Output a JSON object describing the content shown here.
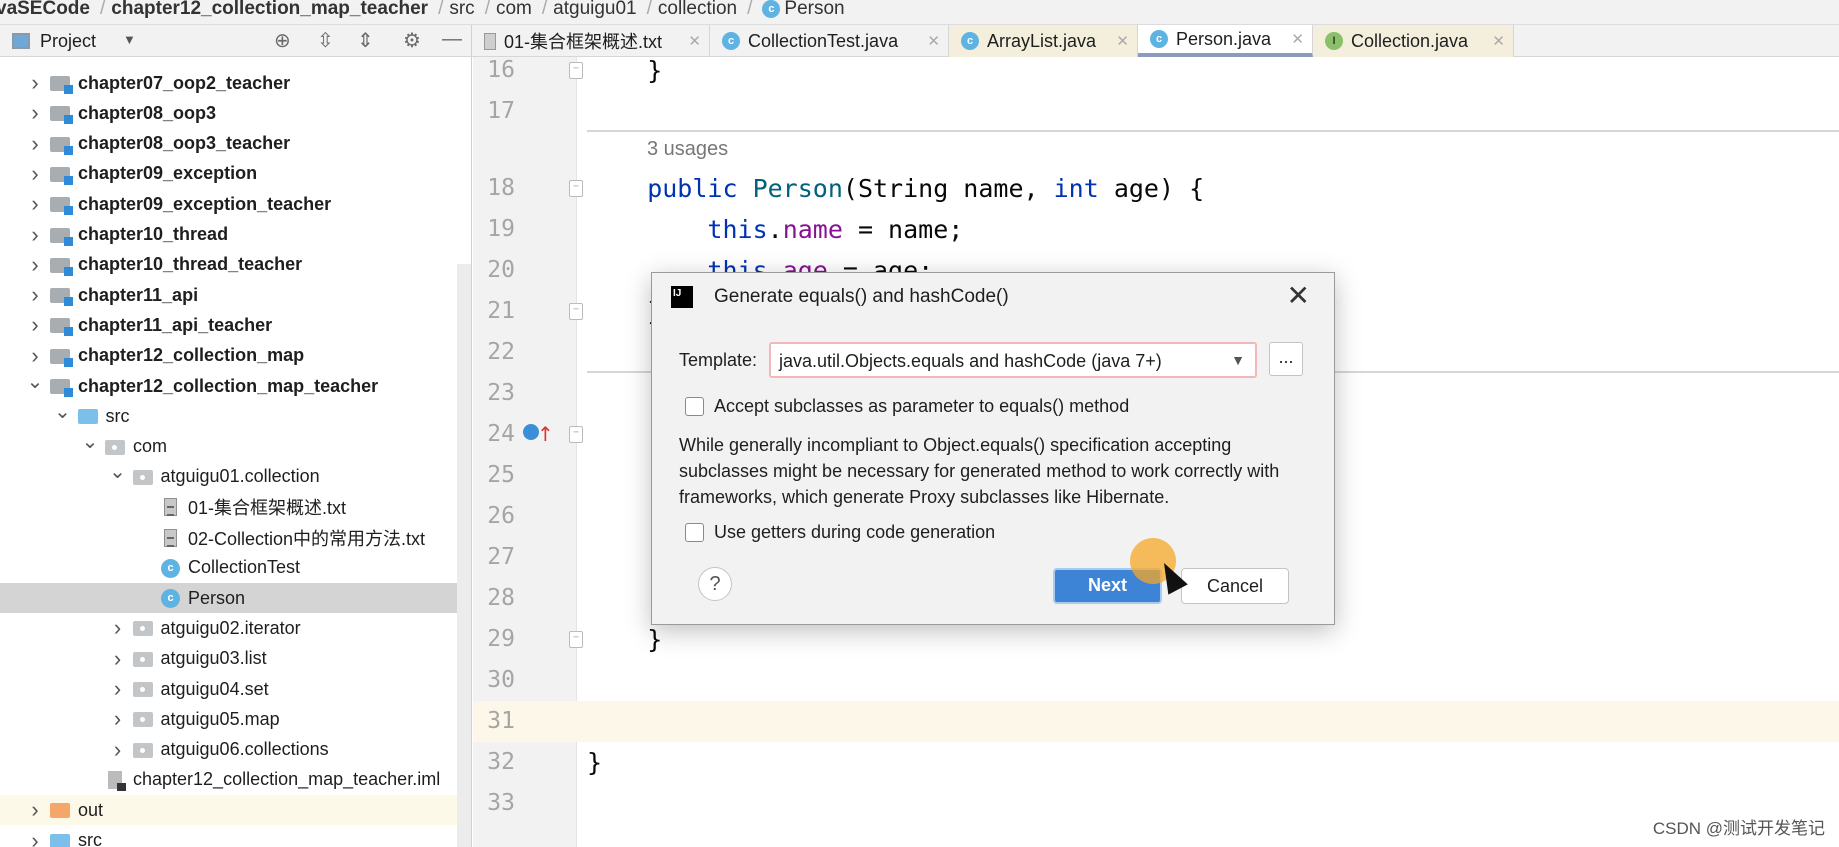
{
  "breadcrumb": [
    "vaSECode",
    "chapter12_collection_map_teacher",
    "src",
    "com",
    "atguigu01",
    "collection",
    "Person"
  ],
  "project_panel": {
    "title": "Project",
    "icons": [
      "locate-icon",
      "expand-all-icon",
      "collapse-all-icon",
      "gear-icon",
      "hide-icon"
    ]
  },
  "tabs": [
    {
      "label": "01-集合框架概述.txt",
      "icon": "text-file",
      "active": false,
      "library": false
    },
    {
      "label": "CollectionTest.java",
      "icon": "class-runnable",
      "active": false,
      "library": false
    },
    {
      "label": "ArrayList.java",
      "icon": "class",
      "active": false,
      "library": true
    },
    {
      "label": "Person.java",
      "icon": "class",
      "active": true,
      "library": false
    },
    {
      "label": "Collection.java",
      "icon": "interface",
      "active": false,
      "library": true
    }
  ],
  "tree": [
    {
      "label": "chapter07_oop2_teacher",
      "level": 0,
      "icon": "module",
      "state": "collapsed",
      "bold": true
    },
    {
      "label": "chapter08_oop3",
      "level": 0,
      "icon": "module",
      "state": "collapsed",
      "bold": true
    },
    {
      "label": "chapter08_oop3_teacher",
      "level": 0,
      "icon": "module",
      "state": "collapsed",
      "bold": true
    },
    {
      "label": "chapter09_exception",
      "level": 0,
      "icon": "module",
      "state": "collapsed",
      "bold": true
    },
    {
      "label": "chapter09_exception_teacher",
      "level": 0,
      "icon": "module",
      "state": "collapsed",
      "bold": true
    },
    {
      "label": "chapter10_thread",
      "level": 0,
      "icon": "module",
      "state": "collapsed",
      "bold": true
    },
    {
      "label": "chapter10_thread_teacher",
      "level": 0,
      "icon": "module",
      "state": "collapsed",
      "bold": true
    },
    {
      "label": "chapter11_api",
      "level": 0,
      "icon": "module",
      "state": "collapsed",
      "bold": true
    },
    {
      "label": "chapter11_api_teacher",
      "level": 0,
      "icon": "module",
      "state": "collapsed",
      "bold": true
    },
    {
      "label": "chapter12_collection_map",
      "level": 0,
      "icon": "module",
      "state": "collapsed",
      "bold": true
    },
    {
      "label": "chapter12_collection_map_teacher",
      "level": 0,
      "icon": "module",
      "state": "expanded",
      "bold": true
    },
    {
      "label": "src",
      "level": 1,
      "icon": "source-folder",
      "state": "expanded"
    },
    {
      "label": "com",
      "level": 2,
      "icon": "package",
      "state": "expanded"
    },
    {
      "label": "atguigu01.collection",
      "level": 3,
      "icon": "package",
      "state": "expanded"
    },
    {
      "label": "01-集合框架概述.txt",
      "level": 4,
      "icon": "text-file",
      "state": "leaf"
    },
    {
      "label": "02-Collection中的常用方法.txt",
      "level": 4,
      "icon": "text-file",
      "state": "leaf"
    },
    {
      "label": "CollectionTest",
      "level": 4,
      "icon": "class-runnable",
      "state": "leaf"
    },
    {
      "label": "Person",
      "level": 4,
      "icon": "class",
      "state": "leaf",
      "selected": true
    },
    {
      "label": "atguigu02.iterator",
      "level": 3,
      "icon": "package",
      "state": "collapsed"
    },
    {
      "label": "atguigu03.list",
      "level": 3,
      "icon": "package",
      "state": "collapsed"
    },
    {
      "label": "atguigu04.set",
      "level": 3,
      "icon": "package",
      "state": "collapsed"
    },
    {
      "label": "atguigu05.map",
      "level": 3,
      "icon": "package",
      "state": "collapsed"
    },
    {
      "label": "atguigu06.collections",
      "level": 3,
      "icon": "package",
      "state": "collapsed"
    },
    {
      "label": "chapter12_collection_map_teacher.iml",
      "level": 2,
      "icon": "iml-file",
      "state": "leaf"
    },
    {
      "label": "out",
      "level": 0,
      "icon": "output-folder",
      "state": "collapsed",
      "highlight": true
    },
    {
      "label": "src",
      "level": 0,
      "icon": "source-folder",
      "state": "collapsed"
    }
  ],
  "editor": {
    "usages_hint": "3 usages",
    "lines": [
      {
        "n": "16",
        "tokens": [
          [
            "",
            "    }"
          ]
        ],
        "fold": true
      },
      {
        "n": "17",
        "tokens": [],
        "sep_after": true
      },
      {
        "n": "18",
        "tokens": [
          [
            "kw",
            "    public "
          ],
          [
            "fn",
            "Person"
          ],
          [
            "",
            "(String name, "
          ],
          [
            "kw",
            "int"
          ],
          [
            "",
            " age) {"
          ]
        ],
        "fold": true,
        "usages": true
      },
      {
        "n": "19",
        "tokens": [
          [
            "kw",
            "        this"
          ],
          [
            "",
            "."
          ],
          [
            "fd",
            "name"
          ],
          [
            "",
            " = name;"
          ]
        ]
      },
      {
        "n": "20",
        "tokens": [
          [
            "kw",
            "        this"
          ],
          [
            "",
            "."
          ],
          [
            "fd",
            "age"
          ],
          [
            "",
            " = age;"
          ]
        ]
      },
      {
        "n": "21",
        "tokens": [
          [
            "",
            "    }"
          ]
        ],
        "fold": true
      },
      {
        "n": "22",
        "tokens": [],
        "sep_after": true
      },
      {
        "n": "23",
        "tokens": []
      },
      {
        "n": "24",
        "tokens": [],
        "fold": true,
        "override": true
      },
      {
        "n": "25",
        "tokens": []
      },
      {
        "n": "26",
        "tokens": []
      },
      {
        "n": "27",
        "tokens": []
      },
      {
        "n": "28",
        "tokens": []
      },
      {
        "n": "29",
        "tokens": [
          [
            "",
            "    }"
          ]
        ],
        "fold": true
      },
      {
        "n": "30",
        "tokens": []
      },
      {
        "n": "31",
        "tokens": [],
        "current": true
      },
      {
        "n": "32",
        "tokens": [
          [
            "",
            "}"
          ]
        ]
      },
      {
        "n": "33",
        "tokens": []
      }
    ]
  },
  "dialog": {
    "title": "Generate equals() and hashCode()",
    "template_label": "Template:",
    "template_value": "java.util.Objects.equals and hashCode (java 7+)",
    "more_label": "...",
    "accept_subclasses": {
      "label": "Accept subclasses as parameter to equals() method",
      "checked": false
    },
    "description": "While generally incompliant to Object.equals() specification accepting subclasses might be necessary for generated method to work correctly with frameworks, which generate Proxy subclasses like Hibernate.",
    "use_getters": {
      "label": "Use getters during code generation",
      "checked": false
    },
    "help_label": "?",
    "next_label": "Next",
    "cancel_label": "Cancel"
  },
  "watermark": "CSDN @测试开发笔记",
  "colors": {
    "accent": "#3d83d6",
    "keyword": "#0033b3",
    "field": "#871094",
    "method": "#00627a",
    "selection": "#d4d4d4",
    "click_indicator": "#f5a828"
  }
}
